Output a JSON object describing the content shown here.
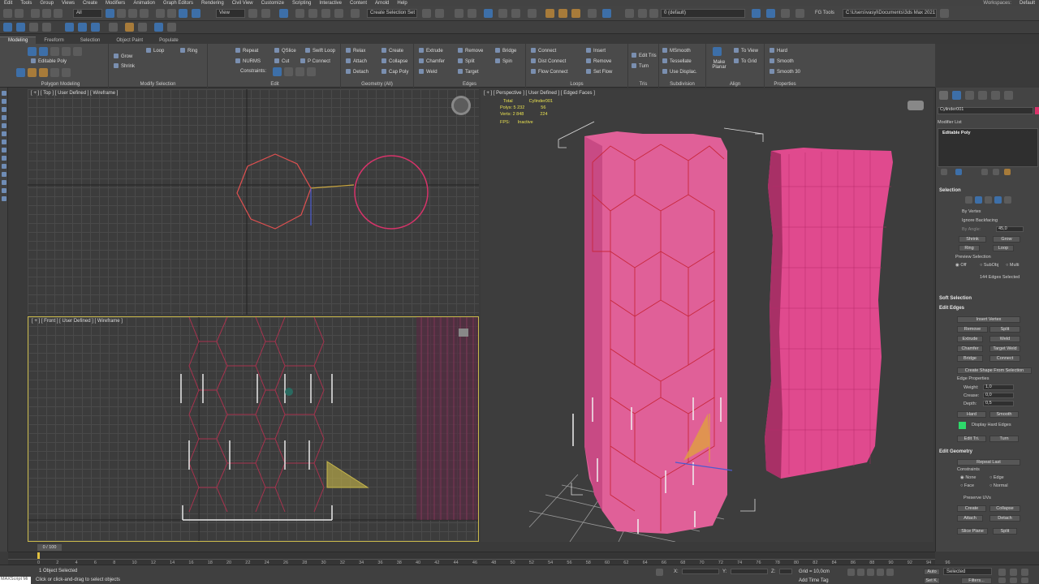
{
  "menu": [
    "Edit",
    "Tools",
    "Group",
    "Views",
    "Create",
    "Modifiers",
    "Animation",
    "Graph Editors",
    "Rendering",
    "Civil View",
    "Customize",
    "Scripting",
    "Interactive",
    "Content",
    "Arnold",
    "Help"
  ],
  "workspaces": "Workspaces:",
  "workspace_value": "Default",
  "toolbar": {
    "filter": "All",
    "view": "View",
    "selection_set": "Create Selection Set",
    "layer": "0 (default)",
    "fg_tools": "FG Tools",
    "path": "C:\\Users\\vasyl\\Documents\\3ds Max 2021"
  },
  "ribbon_tabs": [
    "Modeling",
    "Freeform",
    "Selection",
    "Object Paint",
    "Populate"
  ],
  "ribbon": {
    "polymodel": {
      "title": "Polygon Modeling",
      "item": "Editable Poly"
    },
    "modsel": {
      "title": "Modify Selection",
      "grow": "Grow",
      "shrink": "Shrink",
      "loop": "Loop",
      "ring": "Ring"
    },
    "edit": {
      "title": "Edit",
      "repeat": "Repeat",
      "qslice": "QSlice",
      "swiftloop": "Swift Loop",
      "nurms": "NURMS",
      "cut": "Cut",
      "pconnect": "P Connect",
      "constraints": "Constraints:"
    },
    "geometry": {
      "title": "Geometry (All)",
      "relax": "Relax",
      "create": "Create",
      "attach": "Attach",
      "collapse": "Collapse",
      "detach": "Detach",
      "cappoly": "Cap Poly"
    },
    "edges": {
      "title": "Edges",
      "extrude": "Extrude",
      "remove": "Remove",
      "bridge": "Bridge",
      "chamfer": "Chamfer",
      "split": "Split",
      "spin": "Spin",
      "weld": "Weld",
      "target": "Target"
    },
    "loops": {
      "title": "Loops",
      "connect": "Connect",
      "insert": "Insert",
      "distconnect": "Dist Connect",
      "remove": "Remove",
      "flowconnect": "Flow Connect",
      "setflow": "Set Flow"
    },
    "tris": {
      "title": "Tris",
      "edittris": "Edit Tris",
      "turn": "Turn"
    },
    "subdiv": {
      "title": "Subdivision",
      "msmooth": "MSmooth",
      "tessellate": "Tessellate",
      "usedisplac": "Use Displac."
    },
    "align": {
      "title": "Align",
      "makeplanar": "Make Planar",
      "toview": "To View",
      "togrid": "To Grid"
    },
    "props": {
      "title": "Properties",
      "hard": "Hard",
      "smooth": "Smooth",
      "smooth30": "Smooth 30"
    }
  },
  "viewports": {
    "top": "[ + ] [ Top ] [ User Defined ] [ Wireframe ]",
    "front": "[ + ] [ Front ] [ User Defined ] [ Wireframe ]",
    "persp": "[ + ] [ Perspective ] [ User Defined ] [ Edged Faces ]"
  },
  "stats": {
    "total_label": "Total",
    "object": "Cylinder001",
    "polys_label": "Polys:",
    "polys_total": "5 232",
    "polys_obj": "56",
    "verts_label": "Verts:",
    "verts_total": "2 848",
    "verts_obj": "224",
    "fps_label": "FPS:",
    "fps_value": "Inactive"
  },
  "cmdpanel": {
    "object_name": "Cylinder001",
    "modifier_list": "Modifier List",
    "stack_item": "Editable Poly",
    "selection": "Selection",
    "by_vertex": "By Vertex",
    "ignore_backfacing": "Ignore Backfacing",
    "by_angle": "By Angle:",
    "by_angle_value": "45,0",
    "shrink": "Shrink",
    "grow": "Grow",
    "ring": "Ring",
    "loop": "Loop",
    "preview_selection": "Preview Selection",
    "off": "Off",
    "subobj": "SubObj",
    "multi": "Multi",
    "edges_selected": "144 Edges Selected",
    "soft_selection": "Soft Selection",
    "edit_edges": "Edit Edges",
    "insert_vertex": "Insert Vertex",
    "remove": "Remove",
    "split": "Split",
    "extrude": "Extrude",
    "weld": "Weld",
    "chamfer": "Chamfer",
    "target_weld": "Target Weld",
    "bridge": "Bridge",
    "connect": "Connect",
    "create_shape": "Create Shape From Selection",
    "edge_properties": "Edge Properties",
    "weight": "Weight:",
    "weight_value": "1,0",
    "crease": "Crease:",
    "crease_value": "0,0",
    "depth": "Depth:",
    "depth_value": "0,5",
    "hard": "Hard",
    "smooth": "Smooth",
    "display_hard_edges": "Display Hard Edges",
    "edit_tri": "Edit Tri.",
    "turn": "Turn",
    "edit_geometry": "Edit Geometry",
    "repeat_last": "Repeat Last",
    "constraints": "Constraints",
    "none": "None",
    "edge": "Edge",
    "face": "Face",
    "normal": "Normal",
    "preserve_uvs": "Preserve UVs",
    "create": "Create",
    "collapse": "Collapse",
    "attach": "Attach",
    "detach": "Detach",
    "slice_plane": "Slice Plane",
    "split2": "Split"
  },
  "timeline": {
    "frame": "0 / 100"
  },
  "ticks": [
    "0",
    "2",
    "4",
    "6",
    "8",
    "10",
    "12",
    "14",
    "16",
    "18",
    "20",
    "22",
    "24",
    "26",
    "28",
    "30",
    "32",
    "34",
    "36",
    "38",
    "40",
    "42",
    "44",
    "46",
    "48",
    "50",
    "52",
    "54",
    "56",
    "58",
    "60",
    "62",
    "64",
    "66",
    "68",
    "70",
    "72",
    "74",
    "76",
    "78",
    "80",
    "82",
    "84",
    "86",
    "88",
    "90",
    "92",
    "94",
    "96"
  ],
  "status": {
    "maxscript": "MAXScript Mi",
    "selected": "1 Object Selected",
    "prompt": "Click or click-and-drag to select objects",
    "x_label": "X:",
    "y_label": "Y:",
    "z_label": "Z:",
    "grid": "Grid = 10,0cm",
    "add_time_tag": "Add Time Tag",
    "auto": "Auto",
    "selected_dd": "Selected",
    "setk": "Set K.",
    "filters": "Filters..."
  }
}
